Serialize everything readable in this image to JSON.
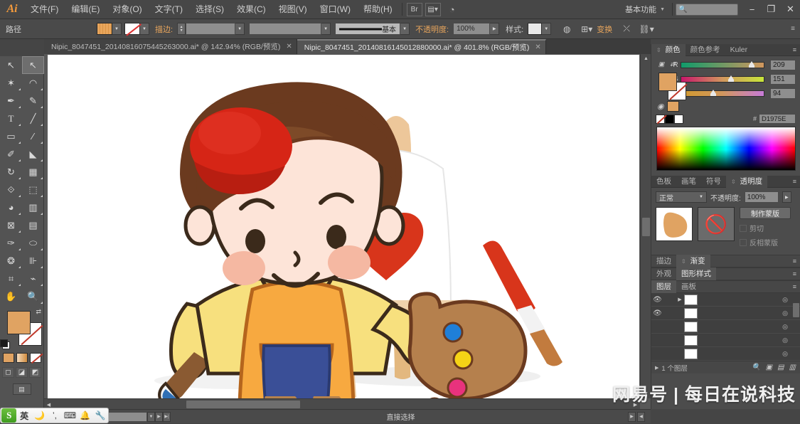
{
  "app": {
    "logo": "Ai",
    "workspace": "基本功能",
    "search_placeholder": ""
  },
  "menu": {
    "items": [
      {
        "label": "文件(F)"
      },
      {
        "label": "编辑(E)"
      },
      {
        "label": "对象(O)"
      },
      {
        "label": "文字(T)"
      },
      {
        "label": "选择(S)"
      },
      {
        "label": "效果(C)"
      },
      {
        "label": "视图(V)"
      },
      {
        "label": "窗口(W)"
      },
      {
        "label": "帮助(H)"
      }
    ],
    "bridge_icon": "bridge-icon",
    "arrange_icon": "arrange-documents-icon",
    "stock_icon": "stock-icon"
  },
  "window_controls": {
    "minimize": "−",
    "restore": "❐",
    "close": "✕"
  },
  "control_bar": {
    "object_label": "路径",
    "fill_label": "fill-swatch",
    "stroke_label": "描边:",
    "stroke_weight": "",
    "stroke_profile": "基本",
    "opacity_label": "不透明度:",
    "opacity_value": "100%",
    "style_label": "样式:",
    "recolor_icon": "recolor-artwork-icon",
    "transform_label": "变换",
    "align_icon": "align-icon",
    "transform_icon": "transform-icon",
    "panel_menu": "panel-menu-icon"
  },
  "tabs": [
    {
      "title": "Nipic_8047451_20140816075445263000.ai* @ 142.94% (RGB/预览)",
      "active": false,
      "close": "✕"
    },
    {
      "title": "Nipic_8047451_20140816145012880000.ai* @ 401.8% (RGB/预览)",
      "active": true,
      "close": "✕"
    }
  ],
  "toolbox": {
    "tools": [
      {
        "name": "selection-tool",
        "glyph": "➚",
        "active": false
      },
      {
        "name": "direct-selection-tool",
        "glyph": "➚",
        "active": true
      },
      {
        "name": "magic-wand-tool",
        "glyph": "✦",
        "active": false
      },
      {
        "name": "lasso-tool",
        "glyph": "◠",
        "active": false
      },
      {
        "name": "pen-tool",
        "glyph": "✒",
        "active": false
      },
      {
        "name": "add-anchor-point-tool",
        "glyph": "✎",
        "active": false
      },
      {
        "name": "type-tool",
        "glyph": "T",
        "active": false
      },
      {
        "name": "line-segment-tool",
        "glyph": "╱",
        "active": false
      },
      {
        "name": "rectangle-tool",
        "glyph": "▭",
        "active": false
      },
      {
        "name": "paintbrush-tool",
        "glyph": "🖌",
        "active": false
      },
      {
        "name": "pencil-tool",
        "glyph": "✐",
        "active": false
      },
      {
        "name": "blob-brush-tool",
        "glyph": "🖊",
        "active": false
      },
      {
        "name": "rotate-tool",
        "glyph": "↻",
        "active": false
      },
      {
        "name": "scale-tool",
        "glyph": "⊞",
        "active": false
      },
      {
        "name": "width-tool",
        "glyph": "⟐",
        "active": false
      },
      {
        "name": "free-transform-tool",
        "glyph": "⬚",
        "active": false
      },
      {
        "name": "shape-builder-tool",
        "glyph": "◕",
        "active": false
      },
      {
        "name": "perspective-grid-tool",
        "glyph": "▦",
        "active": false
      },
      {
        "name": "mesh-tool",
        "glyph": "⊠",
        "active": false
      },
      {
        "name": "gradient-tool",
        "glyph": "▤",
        "active": false
      },
      {
        "name": "eyedropper-tool",
        "glyph": "✑",
        "active": false
      },
      {
        "name": "blend-tool",
        "glyph": "⬮",
        "active": false
      },
      {
        "name": "symbol-sprayer-tool",
        "glyph": "❂",
        "active": false
      },
      {
        "name": "column-graph-tool",
        "glyph": "▥",
        "active": false
      },
      {
        "name": "artboard-tool",
        "glyph": "⌗",
        "active": false
      },
      {
        "name": "slice-tool",
        "glyph": "⌁",
        "active": false
      },
      {
        "name": "hand-tool",
        "glyph": "✋",
        "active": false
      },
      {
        "name": "zoom-tool",
        "glyph": "🔍",
        "active": false
      }
    ],
    "fill_color": "#e0a362",
    "stroke_color": "none",
    "color_modes": [
      "solid-color",
      "gradient",
      "none"
    ],
    "screen_modes": [
      "normal-screen-mode",
      "full-screen-menubar",
      "full-screen"
    ],
    "change_screen_mode": "change-screen-mode-icon"
  },
  "color_panel": {
    "tabs": [
      {
        "label": "颜色",
        "active": true
      },
      {
        "label": "颜色参考",
        "active": false
      },
      {
        "label": "Kuler",
        "active": false
      }
    ],
    "channels": [
      {
        "label": "R",
        "value": "209",
        "pos": 82
      },
      {
        "label": "G",
        "value": "151",
        "pos": 59
      },
      {
        "label": "B",
        "value": "94",
        "pos": 37
      }
    ],
    "hex_prefix": "#",
    "hex": "D1975E",
    "swatches": [
      "none",
      "black",
      "white"
    ]
  },
  "transparency_panel": {
    "tabs": [
      {
        "label": "色板",
        "active": false
      },
      {
        "label": "画笔",
        "active": false
      },
      {
        "label": "符号",
        "active": false
      },
      {
        "label": "透明度",
        "active": true
      }
    ],
    "blend_mode": "正常",
    "opacity_label": "不透明度:",
    "opacity_value": "100%",
    "make_mask_button": "制作蒙版",
    "clip_checkbox": "剪切",
    "invert_checkbox": "反相蒙版",
    "mask_icon": "no-mask-icon"
  },
  "collapsed_panels": [
    {
      "tabs": [
        {
          "label": "描边",
          "active": false
        },
        {
          "label": "渐变",
          "active": true
        }
      ]
    },
    {
      "tabs": [
        {
          "label": "外观",
          "active": false
        },
        {
          "label": "图形样式",
          "active": true
        }
      ]
    },
    {
      "tabs": [
        {
          "label": "图层",
          "active": true
        },
        {
          "label": "画板",
          "active": false
        }
      ]
    }
  ],
  "layers_panel": {
    "rows": [
      {
        "name": "layer-row",
        "label": "",
        "eye": "👁",
        "expand": "▶",
        "target": "◎"
      },
      {
        "name": "layer-row",
        "label": "",
        "eye": "👁",
        "expand": "",
        "target": "◎"
      },
      {
        "name": "layer-row",
        "label": "",
        "eye": "",
        "expand": "",
        "target": "◎"
      },
      {
        "name": "layer-row",
        "label": "",
        "eye": "",
        "expand": "",
        "target": "◎"
      },
      {
        "name": "layer-row",
        "label": "",
        "eye": "",
        "expand": "",
        "target": "◎"
      }
    ],
    "status": "1 个图层",
    "footer_icons": [
      "locate-object-icon",
      "make-sublayer-icon",
      "new-layer-icon",
      "delete-layer-icon"
    ]
  },
  "status_bar": {
    "zoom_value": "",
    "tool_status": "直接选择",
    "prev_icon": "▶",
    "next_icon": "◀"
  },
  "ime": {
    "logo": "S",
    "mode": "英",
    "items": [
      "moon-icon",
      "comma-icon",
      "keyboard-icon",
      "toolbox-icon",
      "wrench-icon"
    ]
  },
  "watermark": "网易号 | 每日在说科技",
  "artwork": {
    "description": "cartoon boy painter with palette and easel",
    "colors": {
      "hat": "#d62516",
      "hair": "#6b3a1f",
      "skin": "#fde4d8",
      "cheek": "#f5b8a2",
      "shirt": "#f7e07e",
      "apron": "#f7a940",
      "pocket": "#ef8b34",
      "pants": "#3a4f97",
      "palette": "#b5804d",
      "easel": "#e8c393",
      "heart": "#d8351b",
      "canvas": "#ffffff"
    }
  }
}
